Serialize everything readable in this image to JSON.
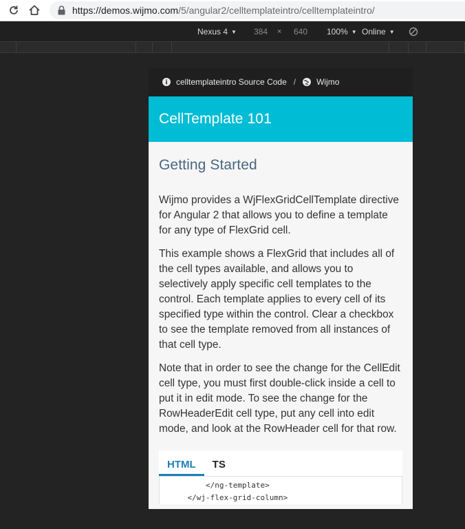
{
  "browser": {
    "url_host": "https://demos.wijmo.com",
    "url_path": "/5/angular2/celltemplateintro/celltemplateintro/"
  },
  "device_toolbar": {
    "device": "Nexus 4",
    "width": "384",
    "height": "640",
    "zoom": "100%",
    "network": "Online"
  },
  "page": {
    "breadcrumb": {
      "source_label": "celltemplateintro Source Code",
      "separator": "/",
      "wijmo_label": "Wijmo"
    },
    "title": "CellTemplate 101",
    "heading": "Getting Started",
    "paragraphs": [
      "Wijmo provides a WjFlexGridCellTemplate directive for Angular 2 that allows you to define a template for any type of FlexGrid cell.",
      "This example shows a FlexGrid that includes all of the cell types available, and allows you to selectively apply specific cell templates to the control. Each template applies to every cell of its specified type within the control. Clear a checkbox to see the template removed from all instances of that cell type.",
      "Note that in order to see the change for the CellEdit cell type, you must first double-click inside a cell to put it in edit mode. To see the change for the RowHeaderEdit cell type, put any cell into edit mode, and look at the RowHeader cell for that row."
    ],
    "tabs": [
      "HTML",
      "TS"
    ],
    "code_lines": [
      "        </ng-template>",
      "    </wj-flex-grid-column>"
    ]
  },
  "icon_colors": {
    "accent": "#00bcd4",
    "tab_active": "#1f7fb8"
  }
}
